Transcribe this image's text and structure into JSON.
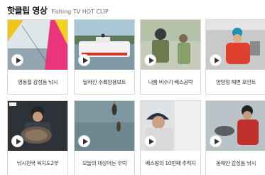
{
  "section": {
    "title": "핫클립 영상",
    "subtitle": "Fishing TV HOT CLIP"
  },
  "clips": [
    {
      "caption": "영동철 감성돔 낚시"
    },
    {
      "caption": "달라진 수륙양용보트"
    },
    {
      "caption": "나름 비수기 배스공략"
    },
    {
      "caption": "양양형 해변 포인트"
    },
    {
      "caption": "낚시천국 욕지도2부"
    },
    {
      "caption": "오늘의 대상어는 우럭"
    },
    {
      "caption": "배스왕의 10번째 추적지"
    },
    {
      "caption": "동해안 감성돔 낚시"
    }
  ]
}
